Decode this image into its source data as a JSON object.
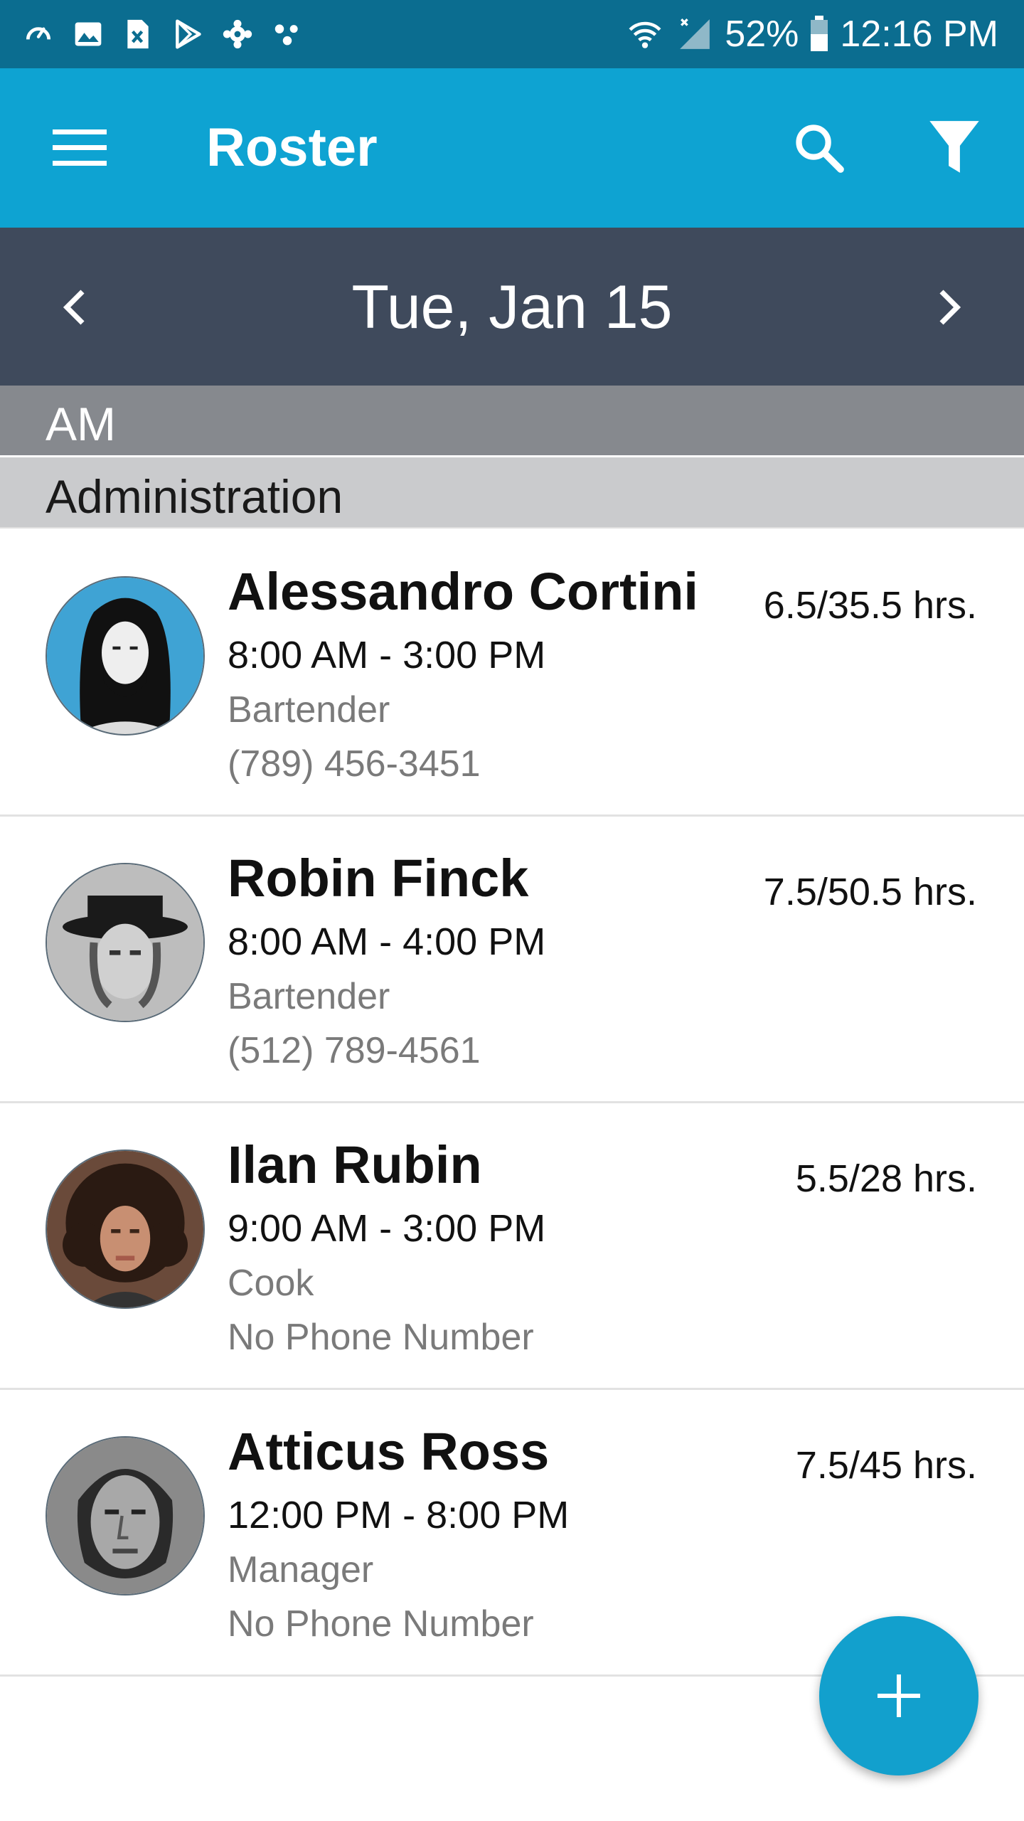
{
  "status_bar": {
    "battery": "52%",
    "time": "12:16 PM",
    "icons": [
      "speedometer-icon",
      "gallery-icon",
      "excel-icon",
      "play-store-icon",
      "settings-gear-icon",
      "dots-icon",
      "wifi-icon",
      "signal-icon",
      "battery-icon"
    ]
  },
  "app_bar": {
    "title": "Roster",
    "icons": [
      "menu-icon",
      "search-icon",
      "filter-icon"
    ]
  },
  "date_nav": {
    "date": "Tue, Jan 15",
    "icons": [
      "chevron-left-icon",
      "chevron-right-icon"
    ]
  },
  "shift_section": "AM",
  "department": "Administration",
  "employees": [
    {
      "name": "Alessandro Cortini",
      "shift": "8:00 AM - 3:00 PM",
      "role": "Bartender",
      "phone": "(789) 456-3451",
      "hours": "6.5/35.5 hrs."
    },
    {
      "name": "Robin Finck",
      "shift": "8:00 AM - 4:00 PM",
      "role": "Bartender",
      "phone": "(512) 789-4561",
      "hours": "7.5/50.5 hrs."
    },
    {
      "name": "Ilan Rubin",
      "shift": "9:00 AM - 3:00 PM",
      "role": "Cook",
      "phone": "No Phone Number",
      "hours": "5.5/28 hrs."
    },
    {
      "name": "Atticus Ross",
      "shift": "12:00 PM - 8:00 PM",
      "role": "Manager",
      "phone": "No Phone Number",
      "hours": "7.5/45 hrs."
    }
  ],
  "fab": {
    "icon": "plus-icon"
  },
  "colors": {
    "status_bar": "#0b6d90",
    "app_bar": "#0ea3d2",
    "date_bar": "#3f4a5c",
    "shift_header": "#86898e",
    "dept_header": "#cacbcd",
    "fab": "#12a0cd"
  }
}
